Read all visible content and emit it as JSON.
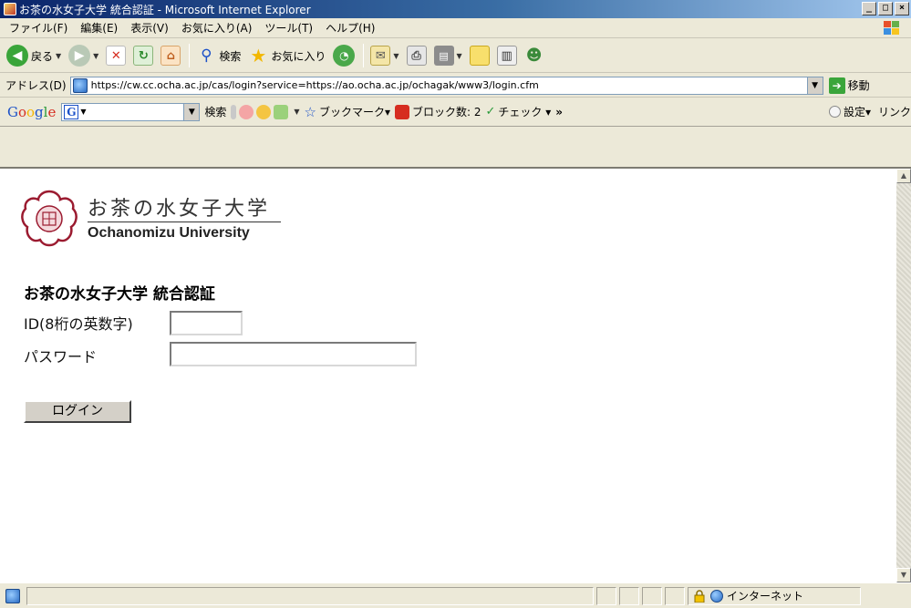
{
  "window": {
    "title": "お茶の水女子大学  統合認証 - Microsoft Internet Explorer",
    "controls": [
      "_",
      "□",
      "×"
    ]
  },
  "menu": [
    "ファイル(F)",
    "編集(E)",
    "表示(V)",
    "お気に入り(A)",
    "ツール(T)",
    "ヘルプ(H)"
  ],
  "toolbar": {
    "back": "戻る",
    "search": "検索",
    "favorites": "お気に入り"
  },
  "address": {
    "label": "アドレス(D)",
    "url": "https://cw.cc.ocha.ac.jp/cas/login?service=https://ao.ocha.ac.jp/ochagak/www3/login.cfm",
    "go": "移動"
  },
  "googlebar": {
    "logo": [
      "G",
      "o",
      "o",
      "g",
      "l",
      "e"
    ],
    "badge": "G",
    "search": "検索",
    "bookmarks": "ブックマーク▾",
    "blocked": "ブロック数: 2",
    "check": "チェック ▾",
    "more": "»",
    "settings": "設定▾",
    "links": "リンク"
  },
  "page": {
    "logo_jp": "お茶の水女子大学",
    "logo_en": "Ochanomizu University",
    "heading": "お茶の水女子大学  統合認証",
    "id_label": "ID(8桁の英数字)",
    "password_label": "パスワード",
    "id_value": "",
    "password_value": "",
    "login_button": "ログイン"
  },
  "status": {
    "zone": "インターネット"
  },
  "colors": {
    "title_bar": "#0a246a",
    "chrome": "#ece9d8",
    "go_green": "#3aa53a",
    "seal_red": "#9b1b30"
  }
}
